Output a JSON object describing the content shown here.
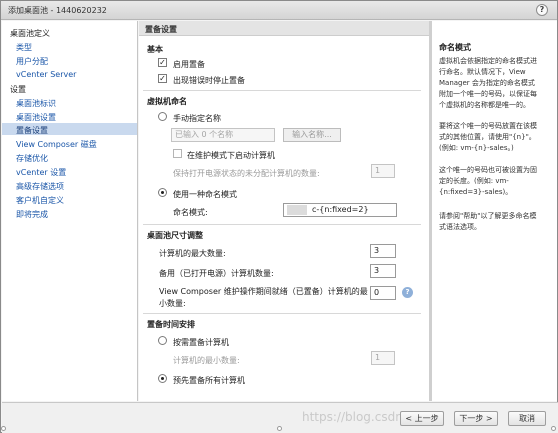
{
  "window": {
    "title": "添加桌面池 - 1440620232",
    "help_glyph": "?"
  },
  "sidebar": {
    "groups": [
      {
        "label": "桌面池定义",
        "items": [
          "类型",
          "用户分配",
          "vCenter Server"
        ]
      },
      {
        "label": "设置",
        "items": [
          "桌面池标识",
          "桌面池设置",
          "置备设置",
          "View Composer 磁盘",
          "存储优化",
          "vCenter 设置",
          "高级存储选项",
          "客户机自定义",
          "即将完成"
        ]
      }
    ],
    "selected": "置备设置"
  },
  "main": {
    "header": "置备设置",
    "basic": {
      "title": "基本",
      "enable_provisioning": {
        "label": "启用置备",
        "checked": true
      },
      "stop_on_error": {
        "label": "出现错误时停止置备",
        "checked": true
      }
    },
    "vm_naming": {
      "title": "虚拟机命名",
      "manual": {
        "label": "手动指定名称",
        "selected": false
      },
      "names_placeholder": "已输入 0 个名称",
      "enter_names_button": "输入名称...",
      "start_maintenance": {
        "label": "在维护模式下启动计算机",
        "checked": false
      },
      "unassigned_on": {
        "label": "保持打开电源状态的未分配计算机的数量:",
        "value": "1"
      },
      "pattern": {
        "label": "使用一种命名模式",
        "selected": true
      },
      "naming_pattern": {
        "label": "命名模式:",
        "value": "c-{n:fixed=2}"
      }
    },
    "pool_sizing": {
      "title": "桌面池尺寸调整",
      "max_machines": {
        "label": "计算机的最大数量:",
        "value": "3"
      },
      "spare_machines": {
        "label": "备用（已打开电源）计算机数量:",
        "value": "3"
      },
      "composer_min_line1": "View Composer 维护操作期间就绪（已置备）计算机的最",
      "composer_min_line2": "小数量:",
      "composer_min_value": "0",
      "info_glyph": "?"
    },
    "schedule": {
      "title": "置备时间安排",
      "on_demand": {
        "label": "按需置备计算机",
        "selected": false
      },
      "min_machines": {
        "label": "计算机的最小数量:",
        "value": "1"
      },
      "up_front": {
        "label": "预先置备所有计算机",
        "selected": true
      }
    }
  },
  "help": {
    "title": "命名模式",
    "paragraphs": [
      "虚拟机会依据指定的命名模式进",
      "行命名。默认情况下，View",
      "Manager 会为指定的命名模式",
      "附加一个唯一的号码，以保证每",
      "个虚拟机的名称都是唯一的。",
      "要将这个唯一的号码放置在该模",
      "式的其他位置，请使用\"{n}\"。",
      "(例如: vm-{n}-sales。)",
      "这个唯一的号码也可被设置为固",
      "定的长度。(例如: vm-",
      "{n:fixed=3}-sales)。",
      "请参阅\"帮助\"以了解更多命名模",
      "式语法选项。"
    ]
  },
  "footer": {
    "back": "< 上一步",
    "next": "下一步 >",
    "cancel": "取消",
    "watermark": "https://blog.csdn.net"
  }
}
